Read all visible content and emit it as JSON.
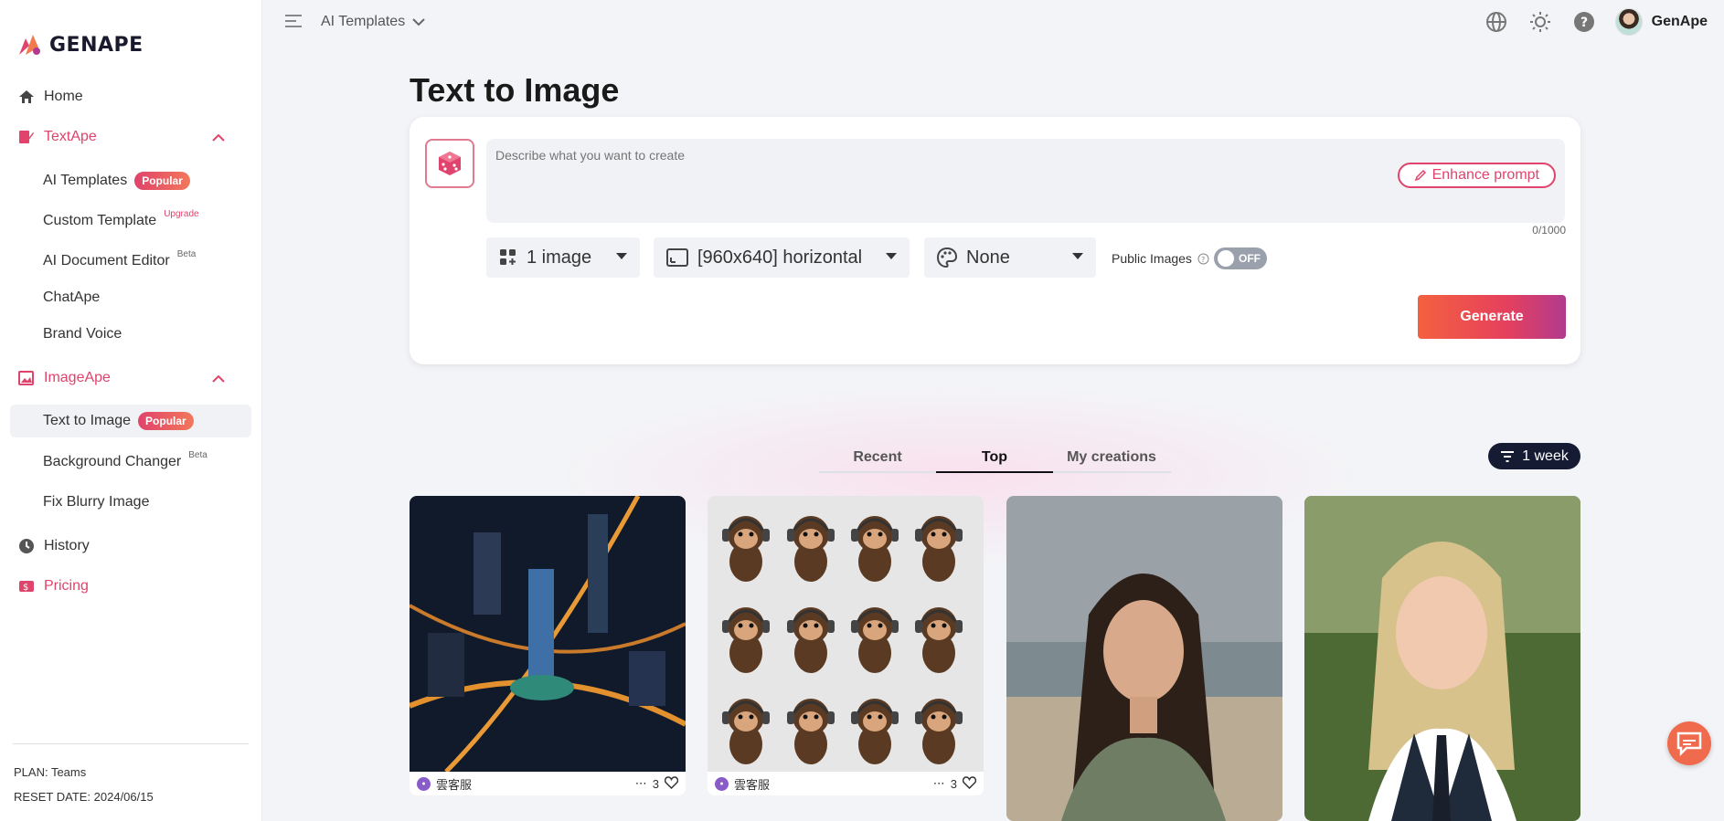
{
  "brand": {
    "name": "GENAPE"
  },
  "sidebar": {
    "home": "Home",
    "textape": {
      "label": "TextApe",
      "items": [
        {
          "label": "AI Templates",
          "badge": "Popular"
        },
        {
          "label": "Custom Template",
          "sup": "Upgrade"
        },
        {
          "label": "AI Document Editor",
          "sup": "Beta"
        },
        {
          "label": "ChatApe"
        },
        {
          "label": "Brand Voice"
        }
      ]
    },
    "imageape": {
      "label": "ImageApe",
      "items": [
        {
          "label": "Text to Image",
          "badge": "Popular"
        },
        {
          "label": "Background Changer",
          "sup": "Beta"
        },
        {
          "label": "Fix Blurry Image"
        }
      ]
    },
    "history": "History",
    "pricing": "Pricing",
    "plan": "PLAN: Teams",
    "reset": "RESET DATE: 2024/06/15"
  },
  "topbar": {
    "breadcrumb": "AI Templates",
    "user": "GenApe"
  },
  "main": {
    "title": "Text to Image",
    "prompt_placeholder": "Describe what you want to create",
    "enhance": "Enhance prompt",
    "char_count": "0/1000",
    "count_select": "1 image",
    "size_select": "[960x640] horizontal",
    "style_select": "None",
    "public_label": "Public Images",
    "toggle": "OFF",
    "generate": "Generate"
  },
  "tabs": [
    "Recent",
    "Top",
    "My creations"
  ],
  "filter": "1 week",
  "gallery": [
    {
      "author": "雲客服",
      "likes": "3"
    },
    {
      "author": "雲客服",
      "likes": "3"
    }
  ],
  "colors": {
    "accent": "#e0436b",
    "dark": "#151b33"
  }
}
